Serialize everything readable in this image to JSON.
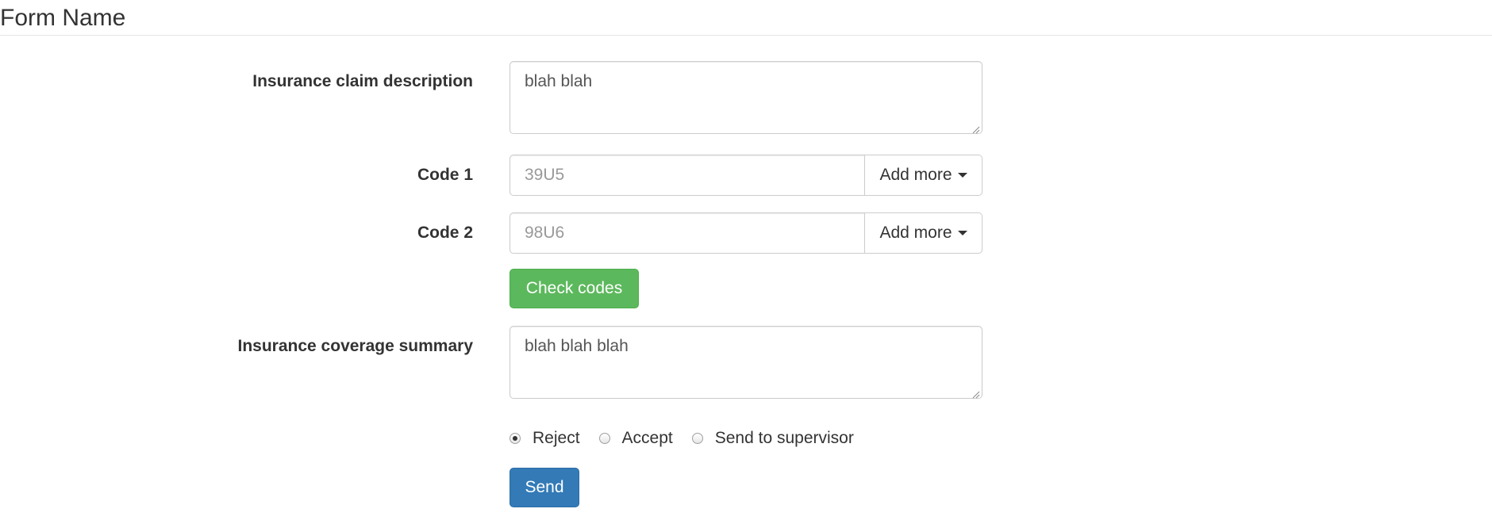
{
  "form": {
    "title": "Form Name",
    "claim_description": {
      "label": "Insurance claim description",
      "value": "blah blah"
    },
    "code1": {
      "label": "Code 1",
      "placeholder": "39U5",
      "value": "",
      "addon_label": "Add more"
    },
    "code2": {
      "label": "Code 2",
      "placeholder": "98U6",
      "value": "",
      "addon_label": "Add more"
    },
    "check_codes_label": "Check codes",
    "coverage_summary": {
      "label": "Insurance coverage summary",
      "value": "blah blah blah"
    },
    "decision": {
      "options": [
        "Reject",
        "Accept",
        "Send to supervisor"
      ],
      "selected": "Reject"
    },
    "send_label": "Send"
  },
  "colors": {
    "success": "#5cb85c",
    "primary": "#337ab7",
    "border": "#cccccc",
    "text": "#333333",
    "placeholder": "#999999"
  },
  "icons": {
    "dropdown": "caret-down-icon",
    "textarea_grip": "resize-grip-icon"
  }
}
